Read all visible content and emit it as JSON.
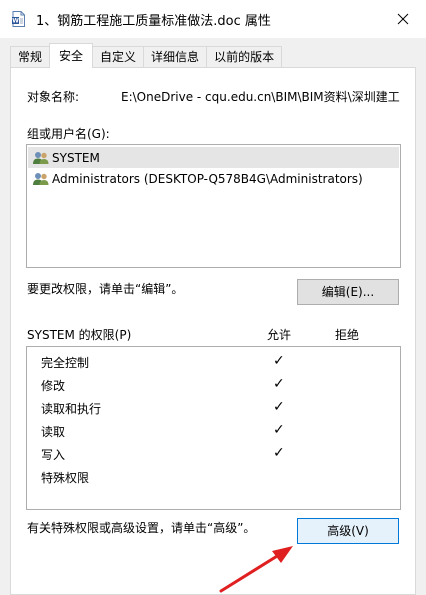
{
  "window": {
    "title": "1、钢筋工程施工质量标准做法.doc 属性",
    "close_icon": "close-icon",
    "doc_icon": "word-doc-icon"
  },
  "tabs": [
    {
      "label": "常规"
    },
    {
      "label": "安全"
    },
    {
      "label": "自定义"
    },
    {
      "label": "详细信息"
    },
    {
      "label": "以前的版本"
    }
  ],
  "active_tab": "安全",
  "security": {
    "object_label": "对象名称:",
    "object_path": "E:\\OneDrive - cqu.edu.cn\\BIM\\BIM资料\\深圳建工",
    "groups_label": "组或用户名(G):",
    "users": [
      {
        "name": "SYSTEM",
        "icon": "user-group-icon"
      },
      {
        "name": "Administrators (DESKTOP-Q578B4G\\Administrators)",
        "icon": "user-group-icon"
      }
    ],
    "edit_hint": "要更改权限，请单击“编辑”。",
    "edit_button": "编辑(E)...",
    "perm_header": "SYSTEM 的权限(P)",
    "allow_header": "允许",
    "deny_header": "拒绝",
    "permissions": [
      {
        "name": "完全控制",
        "allow": "✓",
        "deny": ""
      },
      {
        "name": "修改",
        "allow": "✓",
        "deny": ""
      },
      {
        "name": "读取和执行",
        "allow": "✓",
        "deny": ""
      },
      {
        "name": "读取",
        "allow": "✓",
        "deny": ""
      },
      {
        "name": "写入",
        "allow": "✓",
        "deny": ""
      },
      {
        "name": "特殊权限",
        "allow": "",
        "deny": ""
      }
    ],
    "advanced_hint": "有关特殊权限或高级设置，请单击“高级”。",
    "advanced_button": "高级(V)"
  },
  "annotation": {
    "arrow_color": "#e02020"
  }
}
